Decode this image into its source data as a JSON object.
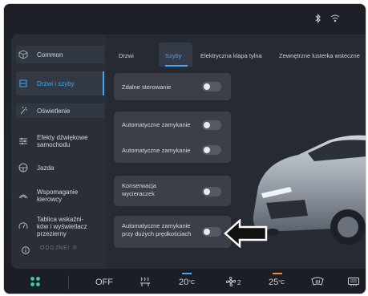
{
  "status_icons": [
    "bluetooth-icon",
    "wifi-icon"
  ],
  "sidebar": {
    "items": [
      {
        "label": "Common",
        "icon": "cube-icon"
      },
      {
        "label": "Drzwi i szyby",
        "icon": "door-icon"
      },
      {
        "label": "Oświetlenie",
        "icon": "light-icon"
      },
      {
        "label": "Efekty dźwiękowe\nsamochodu",
        "icon": "equalizer-icon"
      },
      {
        "label": "Jazda",
        "icon": "steering-wheel-icon"
      },
      {
        "label": "Wspomaganie\nkierowcy",
        "icon": "driver-assist-icon"
      },
      {
        "label": "Tablica wskaźni-\nków i wyświetlacz\nprzezierny",
        "icon": "gauge-icon"
      }
    ],
    "info_icon": "info-icon",
    "logo_text": "ODDJNEI ®"
  },
  "tabs": [
    {
      "label": "Drzwi"
    },
    {
      "label": "Szyby"
    },
    {
      "label": "Elektryczna klapa tylna"
    },
    {
      "label": "Zewnętrzne lusterka wsteczne"
    }
  ],
  "settings": {
    "remote": {
      "label": "Zdalne sterowanie",
      "on": false
    },
    "auto_close_1": {
      "label": "Automatyczne zamykanie",
      "on": false
    },
    "auto_close_2": {
      "label": "Automatyczne zamykanie",
      "on": false
    },
    "wiper": {
      "label": "Konserwacja\nwycieraczek",
      "on": false
    },
    "auto_close_speed": {
      "label": "Automatyczne zamykanie\nprzy dużych prędkościach",
      "on": false
    }
  },
  "bottombar": {
    "apps_icon": "apps-grid-icon",
    "ac_off": "OFF",
    "seat_heat_icon": "seat-heat-icon",
    "left_temp": "20",
    "left_temp_unit": "°C",
    "fan_icon": "fan-icon",
    "fan_level": "2",
    "right_temp": "25",
    "right_temp_unit": "°C",
    "front_defrost_icon": "front-defrost-icon",
    "rear_defrost_icon": "rear-defrost-icon",
    "left_temp_color": "#3fa8f5",
    "right_temp_color": "#f08a3c"
  },
  "colors": {
    "accent": "#3fa8f5"
  }
}
